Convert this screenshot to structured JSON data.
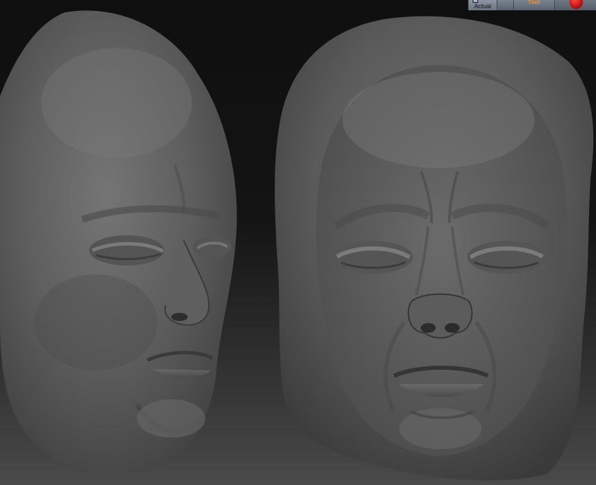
{
  "toolbar": {
    "actual_label": "Actual",
    "tool_label": "Tool",
    "actual_icon": "zoom-actual-icon",
    "record_icon": "record-icon"
  },
  "viewport": {
    "content": "sculpted-head-views",
    "colors": {
      "background_top": "#0f0f0f",
      "background_bottom": "#4a4a4a",
      "clay": "#5a5a5a",
      "toolbar": "#6f7885",
      "accent": "#ff8a1f",
      "record": "#d01818"
    }
  }
}
